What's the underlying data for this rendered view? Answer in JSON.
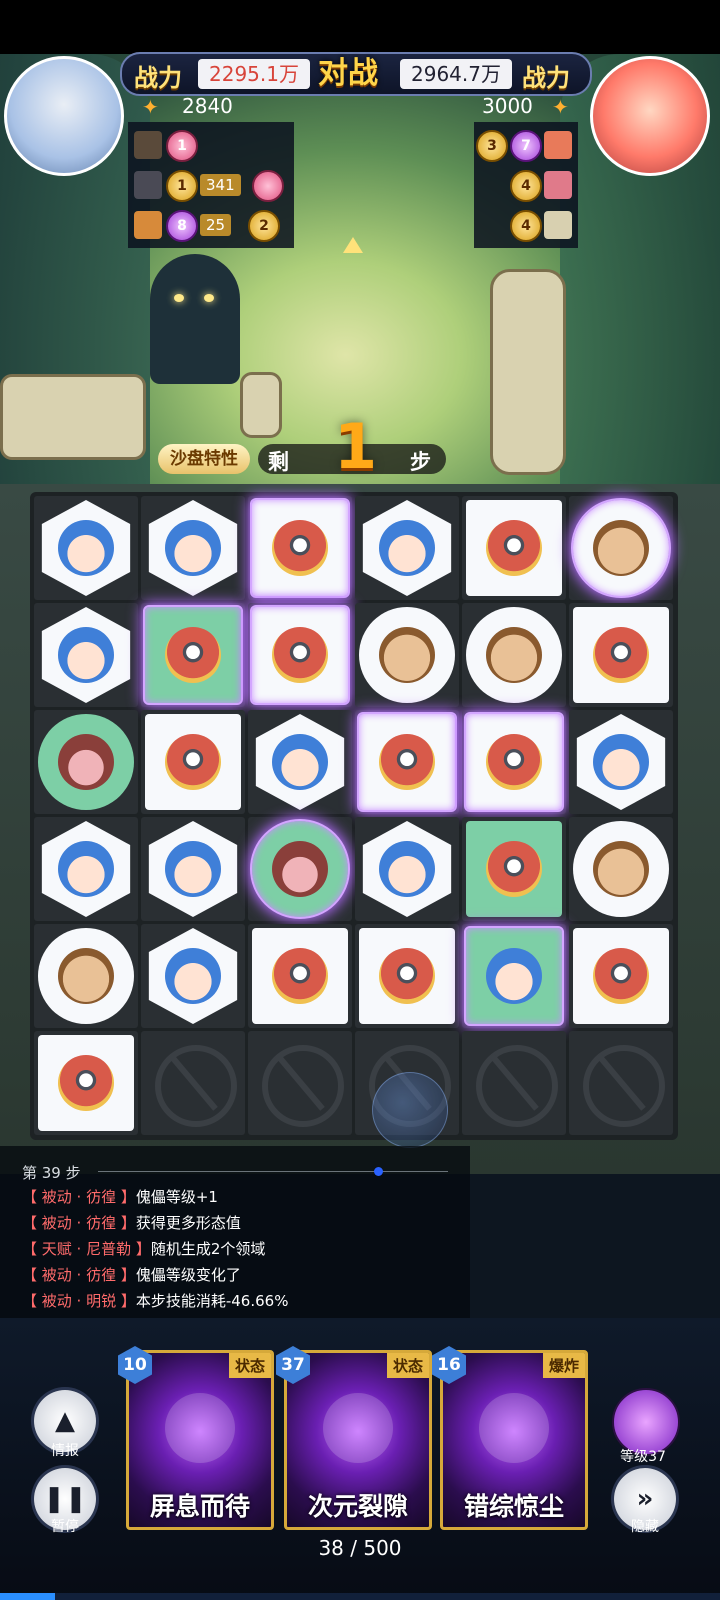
{
  "header": {
    "left_power_label": "战力",
    "left_power": "2295.1万",
    "versus": "对战",
    "right_power": "2964.7万",
    "right_power_label": "战力",
    "left_energy": "2840",
    "right_energy": "3000"
  },
  "skills_left": [
    {
      "badge": "1"
    },
    {
      "badge": "1",
      "count": "341"
    },
    {
      "badge": "8",
      "count": "25",
      "badge2": "2"
    }
  ],
  "skills_right": [
    {
      "badge1": "3",
      "badge2": "7"
    },
    {
      "badge": "4"
    },
    {
      "badge": "4"
    }
  ],
  "steps": {
    "trait_label": "沙盘特性",
    "prefix": "剩",
    "remaining": "1",
    "suffix": "步"
  },
  "board": {
    "rows": [
      [
        "hex-blue-girl",
        "hex-blue-girl",
        "square-monocle",
        "hex-blue-girl",
        "square-monocle",
        "circle-monocle-man"
      ],
      [
        "hex-blue-girl",
        "square-green-monocle",
        "square-monocle",
        "circle-monocle-man",
        "circle-monocle-man",
        "square-monocle"
      ],
      [
        "circle-green-goggles",
        "square-monocle",
        "hex-blue-girl",
        "square-monocle",
        "square-monocle",
        "hex-blue-girl"
      ],
      [
        "hex-blue-girl",
        "hex-blue-girl",
        "circle-green-goggles",
        "hex-blue-girl",
        "square-green-monocle",
        "circle-monocle-man"
      ],
      [
        "circle-monocle-man",
        "hex-blue-girl",
        "square-monocle",
        "square-monocle",
        "square-green-goggle-girl",
        "square-monocle"
      ],
      [
        "square-monocle",
        "locked",
        "locked",
        "locked",
        "locked",
        "locked"
      ]
    ]
  },
  "log": {
    "title": "第 39 步",
    "entries": [
      {
        "source": "【 被动 · 彷徨 】",
        "text": "傀儡等级+1"
      },
      {
        "source": "【 被动 · 彷徨 】",
        "text": "获得更多形态值"
      },
      {
        "source": "【 天赋 · 尼普勒 】",
        "text": "随机生成2个领域"
      },
      {
        "source": "【 被动 · 彷徨 】",
        "text": "傀儡等级变化了"
      },
      {
        "source": "【 被动 · 明锐 】",
        "text": "本步技能消耗-46.66%"
      }
    ]
  },
  "controls": {
    "intel_label": "情报",
    "pause_label": "暂停",
    "level_label": "等级37",
    "hide_label": "隐藏"
  },
  "cards": [
    {
      "cost": "10",
      "tag": "状态",
      "name": "屏息而待"
    },
    {
      "cost": "37",
      "tag": "状态",
      "name": "次元裂隙"
    },
    {
      "cost": "16",
      "tag": "爆炸",
      "name": "错综惊尘"
    }
  ],
  "progress": {
    "text": "38 / 500",
    "value": 38,
    "max": 500
  },
  "colors": {
    "accent_gold": "#ffa918",
    "glow_purple": "#b56cff",
    "log_source_red": "#ff6b6b",
    "card_border": "#d6a93a"
  }
}
